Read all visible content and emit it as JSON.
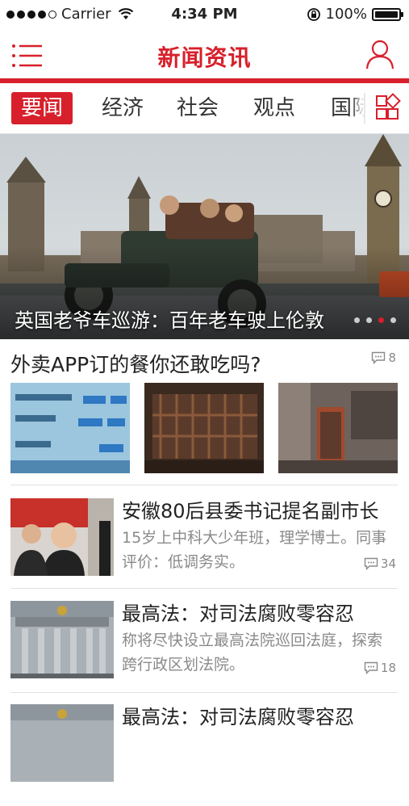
{
  "status_bar": {
    "carrier": "Carrier",
    "time": "4:34 PM",
    "battery": "100%",
    "battery_level": 1.0
  },
  "header": {
    "title": "新闻资讯"
  },
  "tabs": [
    {
      "label": "要闻",
      "active": true
    },
    {
      "label": "经济"
    },
    {
      "label": "社会"
    },
    {
      "label": "观点"
    },
    {
      "label": "国际"
    }
  ],
  "banner": {
    "caption": "英国老爷车巡游：百年老车驶上伦敦",
    "page_count": 4,
    "active_page": 2
  },
  "news": [
    {
      "title": "外卖APP订的餐你还敢吃吗?",
      "comments": "8"
    },
    {
      "title": "安徽80后县委书记提名副市长",
      "desc": "15岁上中科大少年班，理学博士。同事评价：低调务实。",
      "comments": "34"
    },
    {
      "title": "最高法：对司法腐败零容忍",
      "desc": "称将尽快设立最高法院巡回法庭，探索跨行政区划法院。",
      "comments": "18"
    },
    {
      "title": "最高法：对司法腐败零容忍"
    }
  ],
  "colors": {
    "accent": "#d7202b",
    "muted": "#8a8a8a"
  }
}
